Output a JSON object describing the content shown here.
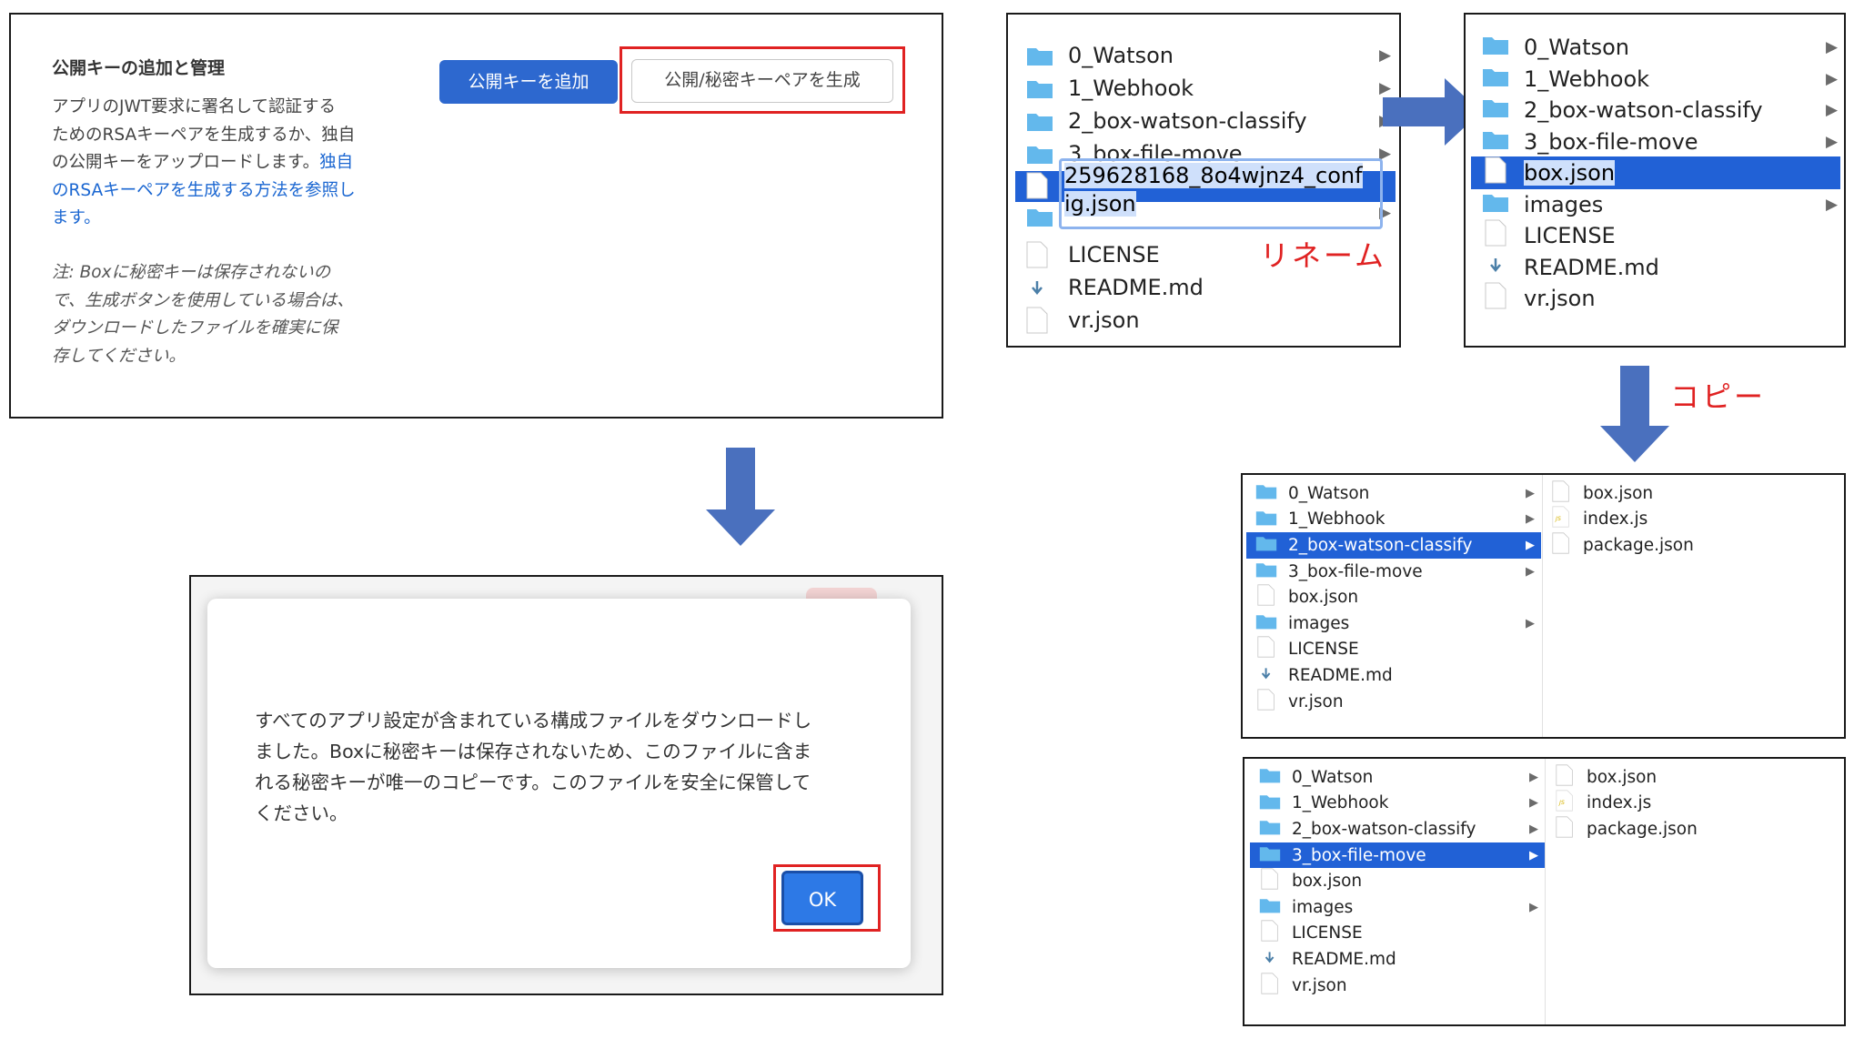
{
  "key_panel": {
    "heading": "公開キーの追加と管理",
    "desc_lines": [
      "アプリのJWT要求に署名して認証する",
      "ためのRSAキーペアを生成するか、独自",
      "の公開キーをアップロードします。"
    ],
    "link_parts": [
      "独自",
      "のRSAキーペアを生成する方法を参照し",
      "ます。"
    ],
    "note_lines": [
      "注: Boxに秘密キーは保存されないの",
      "で、生成ボタンを使用している場合は、",
      "ダウンロードしたファイルを確実に保",
      "存してください。"
    ],
    "add_key_label": "公開キーを追加",
    "generate_label": "公開/秘密キーペアを生成"
  },
  "dialog": {
    "lines": [
      "すべてのアプリ設定が含まれている構成ファイルをダウンロードし",
      "ました。Boxに秘密キーは保存されないため、このファイルに含ま",
      "れる秘密キーが唯一のコピーです。このファイルを安全に保管して",
      "ください。"
    ],
    "ok_label": "OK"
  },
  "labels": {
    "rename": "リネーム",
    "copy": "コピー"
  },
  "finder_before": {
    "items": [
      "0_Watson",
      "1_Webhook",
      "2_box-watson-classify",
      "3_box-file-move"
    ],
    "renaming_line1": "259628168_8o4wjnz4_conf",
    "renaming_line2": "ig.json",
    "after": [
      "LICENSE",
      "README.md",
      "vr.json"
    ]
  },
  "finder_after": {
    "items": [
      "0_Watson",
      "1_Webhook",
      "2_box-watson-classify",
      "3_box-file-move",
      "box.json",
      "images",
      "LICENSE",
      "README.md",
      "vr.json"
    ]
  },
  "finder_copy1": {
    "items": [
      "0_Watson",
      "1_Webhook",
      "2_box-watson-classify",
      "3_box-file-move",
      "box.json",
      "images",
      "LICENSE",
      "README.md",
      "vr.json"
    ],
    "right_items": [
      "box.json",
      "index.js",
      "package.json"
    ]
  },
  "finder_copy2": {
    "items": [
      "0_Watson",
      "1_Webhook",
      "2_box-watson-classify",
      "3_box-file-move",
      "box.json",
      "images",
      "LICENSE",
      "README.md",
      "vr.json"
    ],
    "right_items": [
      "box.json",
      "index.js",
      "package.json"
    ]
  },
  "colors": {
    "accent": "#2d68cf",
    "highlight": "#e02222",
    "selection": "#2161d6",
    "arrow": "#4a70be",
    "folder": "#63b8ec"
  }
}
